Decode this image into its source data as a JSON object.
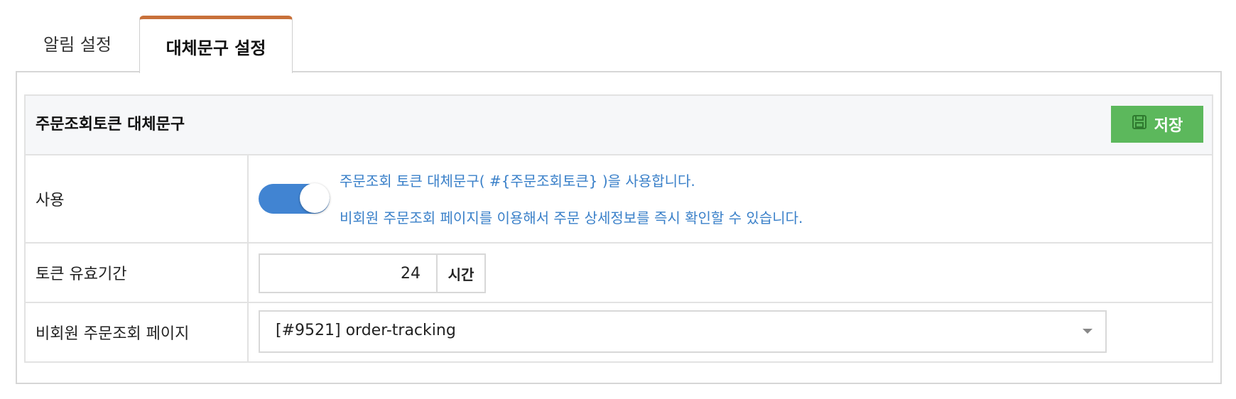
{
  "tabs": [
    {
      "label": "알림 설정",
      "active": false
    },
    {
      "label": "대체문구 설정",
      "active": true
    }
  ],
  "section": {
    "title": "주문조회토큰 대체문구",
    "save_label": "저장",
    "save_icon": "floppy-disk-icon",
    "save_color": "#5cb85c"
  },
  "rows": {
    "use": {
      "label": "사용",
      "toggle_on": true,
      "desc1": "주문조회 토큰 대체문구( #{주문조회토큰} )을 사용합니다.",
      "desc2": "비회원 주문조회 페이지를 이용해서 주문 상세정보를 즉시 확인할 수 있습니다."
    },
    "token_period": {
      "label": "토큰 유효기간",
      "value": "24",
      "unit": "시간"
    },
    "guest_page": {
      "label": "비회원 주문조회 페이지",
      "selected": "[#9521] order-tracking"
    }
  },
  "colors": {
    "tab_accent": "#c8713a",
    "toggle_on": "#4184d2",
    "desc_text": "#3a80c9"
  }
}
